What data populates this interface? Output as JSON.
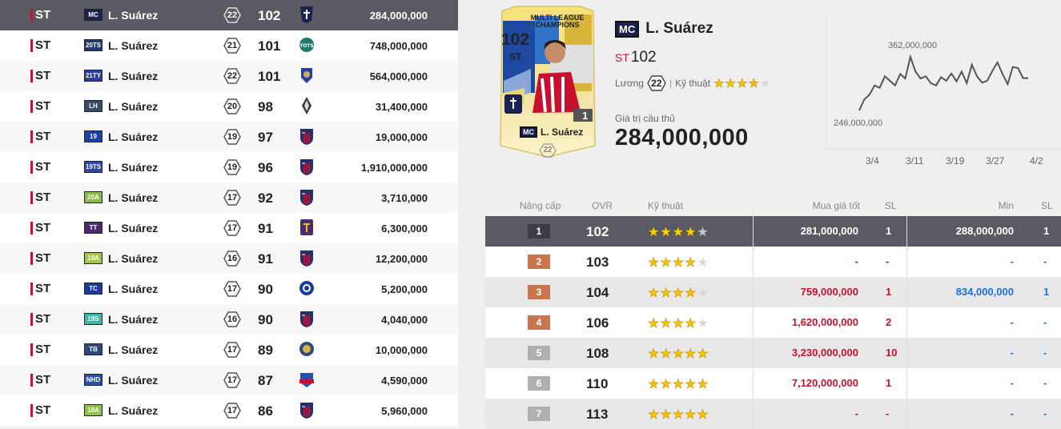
{
  "player_list": [
    {
      "pos": "ST",
      "season": "MC",
      "season_color": "#1b2250",
      "name": "L. Suárez",
      "lvl": "22",
      "ovr": "102",
      "price": "284,000,000",
      "club": "ml"
    },
    {
      "pos": "ST",
      "season": "20TS",
      "season_color": "#1f3d6b",
      "name": "L. Suárez",
      "lvl": "21",
      "ovr": "101",
      "price": "748,000,000",
      "club": "tots"
    },
    {
      "pos": "ST",
      "season": "21TY",
      "season_color": "#2a3f9d",
      "name": "L. Suárez",
      "lvl": "22",
      "ovr": "101",
      "price": "564,000,000",
      "club": "toty"
    },
    {
      "pos": "ST",
      "season": "LH",
      "season_color": "#3b4a66",
      "name": "L. Suárez",
      "lvl": "20",
      "ovr": "98",
      "price": "31,400,000",
      "club": "lh"
    },
    {
      "pos": "ST",
      "season": "19",
      "season_color": "#1e3fa8",
      "name": "L. Suárez",
      "lvl": "19",
      "ovr": "97",
      "price": "19,000,000",
      "club": "atm"
    },
    {
      "pos": "ST",
      "season": "19TS",
      "season_color": "#2f45a8",
      "name": "L. Suárez",
      "lvl": "19",
      "ovr": "96",
      "price": "1,910,000,000",
      "club": "atm"
    },
    {
      "pos": "ST",
      "season": "20A",
      "season_color": "#8fb84a",
      "name": "L. Suárez",
      "lvl": "17",
      "ovr": "92",
      "price": "3,710,000",
      "club": "atm"
    },
    {
      "pos": "ST",
      "season": "TT",
      "season_color": "#4b2a6e",
      "name": "L. Suárez",
      "lvl": "17",
      "ovr": "91",
      "price": "6,300,000",
      "club": "tt"
    },
    {
      "pos": "ST",
      "season": "19A",
      "season_color": "#a6c64a",
      "name": "L. Suárez",
      "lvl": "16",
      "ovr": "91",
      "price": "12,200,000",
      "club": "atm"
    },
    {
      "pos": "ST",
      "season": "TC",
      "season_color": "#1a3b9c",
      "name": "L. Suárez",
      "lvl": "17",
      "ovr": "90",
      "price": "5,200,000",
      "club": "tc"
    },
    {
      "pos": "ST",
      "season": "19S",
      "season_color": "#3fb8a8",
      "name": "L. Suárez",
      "lvl": "16",
      "ovr": "90",
      "price": "4,040,000",
      "club": "atm"
    },
    {
      "pos": "ST",
      "season": "TB",
      "season_color": "#2d4a7a",
      "name": "L. Suárez",
      "lvl": "17",
      "ovr": "89",
      "price": "10,000,000",
      "club": "tb"
    },
    {
      "pos": "ST",
      "season": "NHD",
      "season_color": "#2a4fa8",
      "name": "L. Suárez",
      "lvl": "17",
      "ovr": "87",
      "price": "4,590,000",
      "club": "nhd"
    },
    {
      "pos": "ST",
      "season": "18A",
      "season_color": "#8fc44a",
      "name": "L. Suárez",
      "lvl": "17",
      "ovr": "86",
      "price": "5,960,000",
      "club": "atm"
    }
  ],
  "card": {
    "ovr": "102",
    "pos": "ST",
    "season_title": "MULTI LEAGUE CHAMPIONS",
    "season": "MC",
    "name": "L. Suárez",
    "lvl": "22",
    "level_badge": "1"
  },
  "detail": {
    "season": "MC",
    "name": "L. Suárez",
    "pos": "ST",
    "ovr": "102",
    "salary_label": "Lương",
    "salary": "22",
    "skill_label": "Kỹ thuật",
    "skill_stars": 4,
    "price_label": "Giá trị cầu thủ",
    "price": "284,000,000"
  },
  "chart_data": {
    "type": "line",
    "max_label": "362,000,000",
    "min_label": "246,000,000",
    "x_ticks": [
      "3/4",
      "3/11",
      "3/19",
      "3/27",
      "4/2"
    ],
    "values": [
      246,
      270,
      280,
      300,
      295,
      320,
      310,
      300,
      325,
      315,
      362,
      330,
      315,
      320,
      305,
      300,
      318,
      310,
      326,
      309,
      330,
      305,
      345,
      320,
      306,
      310,
      331,
      350,
      325,
      303,
      340,
      338,
      316,
      316
    ],
    "ylim": [
      246,
      362
    ]
  },
  "table": {
    "headers": {
      "upgrade": "Nâng cấp",
      "ovr": "OVR",
      "skill": "Kỹ thuật",
      "buy": "Mua giá tốt",
      "sl": "SL",
      "min": "Min",
      "sl2": "SL"
    },
    "rows": [
      {
        "lvl": "1",
        "ovr": "102",
        "stars": 4,
        "buy": "281,000,000",
        "sl": "1",
        "min": "288,000,000",
        "sl2": "1",
        "lvl_color": "#555"
      },
      {
        "lvl": "2",
        "ovr": "103",
        "stars": 4,
        "buy": "-",
        "sl": "-",
        "min": "-",
        "sl2": "-",
        "lvl_color": "#c9764f"
      },
      {
        "lvl": "3",
        "ovr": "104",
        "stars": 4,
        "buy": "759,000,000",
        "sl": "1",
        "min": "834,000,000",
        "sl2": "1",
        "lvl_color": "#c9764f"
      },
      {
        "lvl": "4",
        "ovr": "106",
        "stars": 4,
        "buy": "1,620,000,000",
        "sl": "2",
        "min": "-",
        "sl2": "-",
        "lvl_color": "#c9764f"
      },
      {
        "lvl": "5",
        "ovr": "108",
        "stars": 5,
        "buy": "3,230,000,000",
        "sl": "10",
        "min": "-",
        "sl2": "-",
        "lvl_color": "#b0b0b0"
      },
      {
        "lvl": "6",
        "ovr": "110",
        "stars": 5,
        "buy": "7,120,000,000",
        "sl": "1",
        "min": "-",
        "sl2": "-",
        "lvl_color": "#b0b0b0"
      },
      {
        "lvl": "7",
        "ovr": "113",
        "stars": 5,
        "buy": "-",
        "sl": "-",
        "min": "-",
        "sl2": "-",
        "lvl_color": "#b0b0b0"
      }
    ]
  }
}
